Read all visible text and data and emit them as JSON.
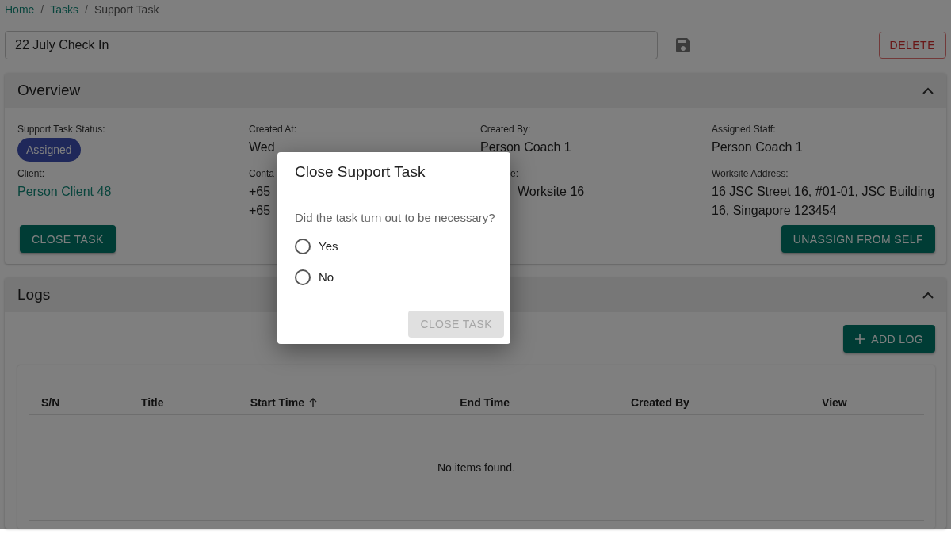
{
  "breadcrumbs": [
    {
      "label": "Home",
      "kind": "link"
    },
    {
      "label": "Tasks",
      "kind": "link"
    },
    {
      "label": "Support Task",
      "kind": "current"
    }
  ],
  "breadcrumb_separator": "/",
  "task_title": {
    "value": "22 July Check In"
  },
  "delete_button": "DELETE",
  "overview": {
    "title": "Overview",
    "expanded": true,
    "fields": [
      {
        "label": "Support Task Status:",
        "kind": "chip",
        "values": [
          "Assigned"
        ]
      },
      {
        "label": "Created At:",
        "kind": "text",
        "values": [
          "Wed"
        ]
      },
      {
        "label": "Created By:",
        "kind": "text",
        "values": [
          "Person Coach 1"
        ]
      },
      {
        "label": "Assigned Staff:",
        "kind": "text",
        "values": [
          "Person Coach 1"
        ]
      },
      {
        "label": "Client:",
        "kind": "link",
        "values": [
          "Person Client 48"
        ]
      },
      {
        "label": "Conta",
        "kind": "text",
        "values": [
          "+65",
          "+65"
        ]
      },
      {
        "label": "e:",
        "kind": "cut",
        "values": [
          "Worksite 16"
        ]
      },
      {
        "label": "Worksite Address:",
        "kind": "text",
        "values": [
          "16 JSC Street 16, #01-01, JSC Building 16, Singapore 123454"
        ]
      }
    ],
    "close_button": "CLOSE TASK",
    "unassign_button": "UNASSIGN FROM SELF"
  },
  "logs": {
    "title": "Logs",
    "expanded": true,
    "add_button": "ADD LOG",
    "columns": [
      {
        "label": "S/N",
        "sorted": false
      },
      {
        "label": "Title",
        "sorted": false
      },
      {
        "label": "Start Time",
        "sorted": true
      },
      {
        "label": "End Time",
        "sorted": false
      },
      {
        "label": "Created By",
        "sorted": false
      },
      {
        "label": "View",
        "sorted": false
      }
    ],
    "empty_message": "No items found."
  },
  "dialog": {
    "title": "Close Support Task",
    "question": "Did the task turn out to be necessary?",
    "options": [
      {
        "label": "Yes",
        "selected": false
      },
      {
        "label": "No",
        "selected": false
      }
    ],
    "confirm": {
      "label": "CLOSE TASK",
      "disabled": true
    }
  }
}
